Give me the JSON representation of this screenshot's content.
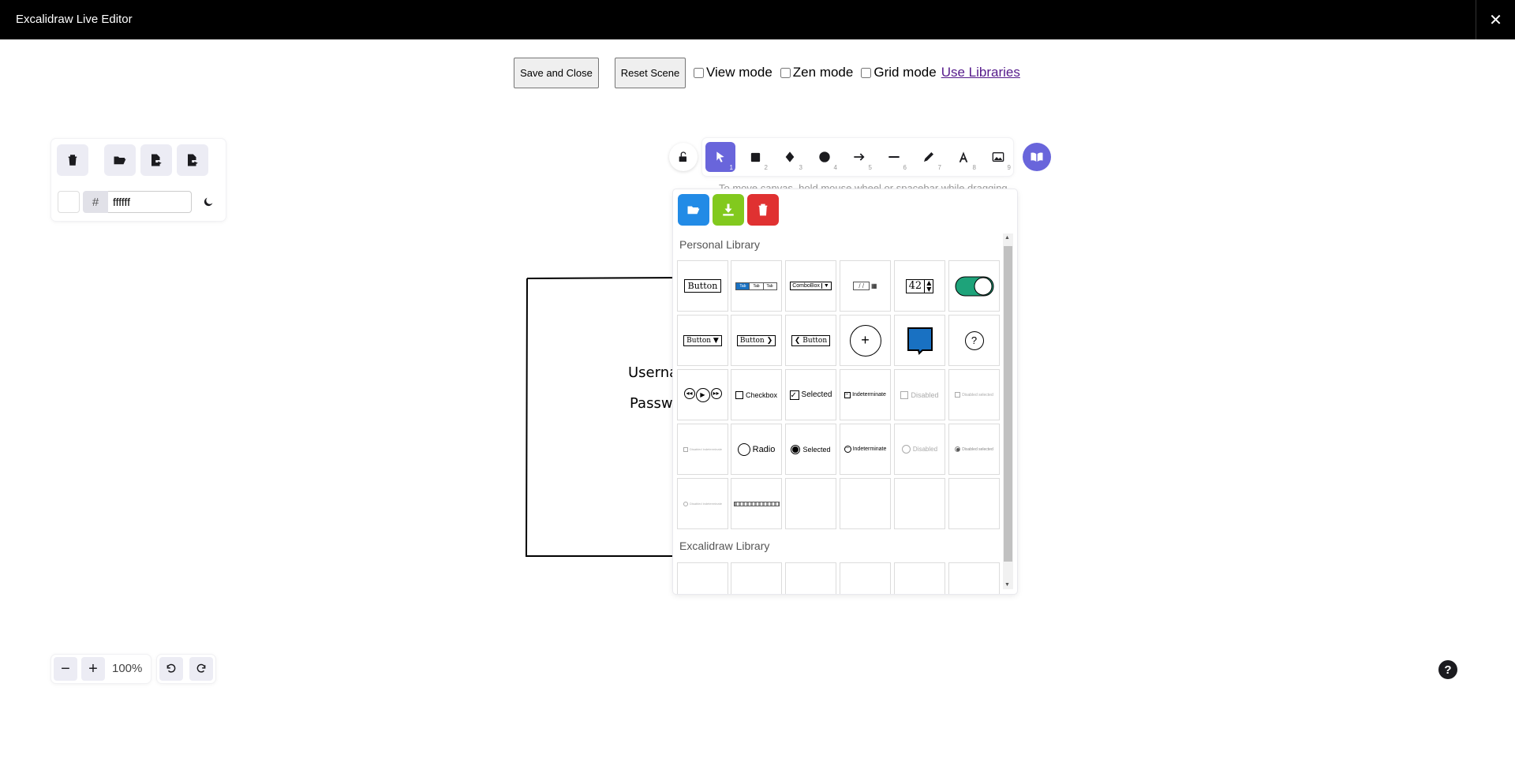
{
  "window": {
    "title": "Excalidraw Live Editor",
    "close_glyph": "✕"
  },
  "topbar": {
    "save_close_label": "Save and Close",
    "reset_label": "Reset Scene",
    "view_mode_label": "View mode",
    "zen_mode_label": "Zen mode",
    "grid_mode_label": "Grid mode",
    "use_libraries_label": "Use Libraries"
  },
  "canvas_menu": {
    "hash_label": "#",
    "bg_color_value": "ffffff"
  },
  "toolbar": {
    "tools": [
      {
        "key": "1",
        "icon": "pointer-icon"
      },
      {
        "key": "2",
        "icon": "rectangle-icon"
      },
      {
        "key": "3",
        "icon": "diamond-icon"
      },
      {
        "key": "4",
        "icon": "ellipse-icon"
      },
      {
        "key": "5",
        "icon": "arrow-icon"
      },
      {
        "key": "6",
        "icon": "line-icon"
      },
      {
        "key": "7",
        "icon": "pencil-icon"
      },
      {
        "key": "8",
        "icon": "text-icon"
      },
      {
        "key": "9",
        "icon": "image-icon"
      }
    ],
    "hint": "To move canvas, hold mouse wheel or spacebar while dragging"
  },
  "library": {
    "personal_title": "Personal Library",
    "excalidraw_title": "Excalidraw Library",
    "items": {
      "button": "Button",
      "combobox": "ComboBox",
      "date": "/ /",
      "number": "42",
      "plus": "+",
      "question": "?",
      "checkbox": "Checkbox",
      "selected": "Selected",
      "indeterminate": "Indeterminate",
      "disabled": "Disabled",
      "disabled_selected": "Disabled selected",
      "disabled_indeterminate": "Disabled indeterminate",
      "radio": "Radio",
      "tabs": [
        "Tab",
        "Tab",
        "Tab"
      ]
    }
  },
  "canvas": {
    "username_label": "Userna",
    "password_label": "Passw"
  },
  "footer": {
    "zoom_out": "−",
    "zoom_in": "+",
    "zoom_level": "100%",
    "help_glyph": "?"
  },
  "colors": {
    "accent": "#6965db",
    "lib_open_btn": "#228be6",
    "lib_save_btn": "#82c91e",
    "lib_delete_btn": "#e03131",
    "toggle_green": "#1ea37a",
    "bubble_blue": "#1971c2"
  }
}
